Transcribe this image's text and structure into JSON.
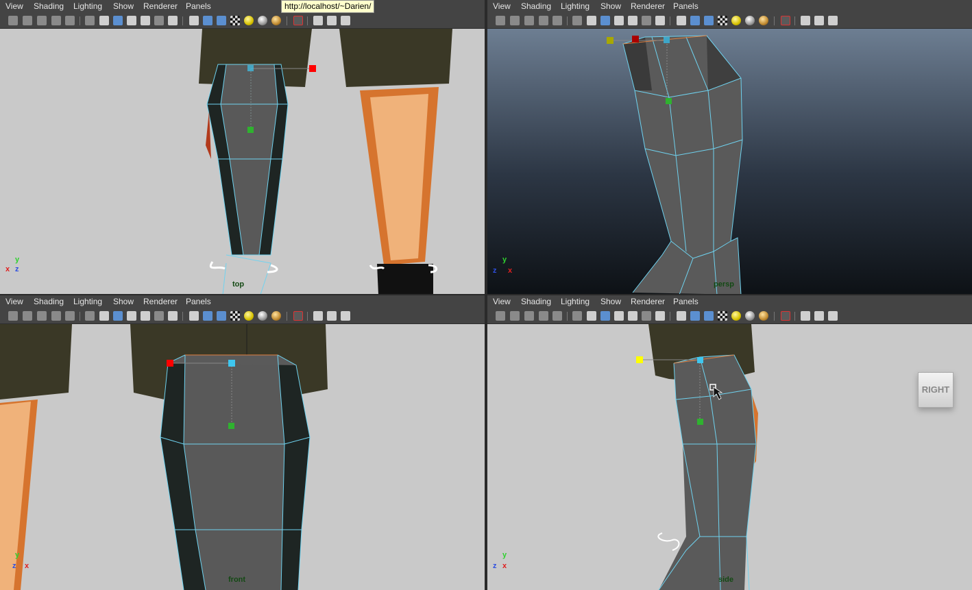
{
  "menu": [
    "View",
    "Shading",
    "Lighting",
    "Show",
    "Renderer",
    "Panels"
  ],
  "tooltip": "http://localhost/~Darien/",
  "viewports": {
    "top": {
      "label": "top",
      "axis": {
        "a": "y",
        "b": "x",
        "c": "z"
      }
    },
    "persp": {
      "label": "persp",
      "axis": {
        "a": "y",
        "b": "z",
        "c": "x"
      }
    },
    "front": {
      "label": "front",
      "axis": {
        "a": "y",
        "b": "z",
        "c": "x"
      }
    },
    "side": {
      "label": "side",
      "axis": {
        "a": "y",
        "b": "z",
        "c": "x"
      },
      "viewcube": "RIGHT"
    }
  },
  "toolbar_icons": [
    "camera-icon",
    "camera-attr-icon",
    "bookmark-icon",
    "image-plane-icon",
    "grid-icon",
    "wireframe-icon",
    "smooth-shade-icon",
    "textured-icon",
    "lights-icon",
    "xray-icon",
    "isolate-icon",
    "select-icon",
    "resolution-gate-icon"
  ],
  "colors": {
    "panel_bg": "#444444",
    "ortho_bg": "#c9c9c9",
    "persp_top": "#6d7e92",
    "persp_bottom": "#101418",
    "mesh_face": "#5a5a5a",
    "mesh_edge": "#6fd3f0",
    "handle_red": "#ff0000",
    "handle_cyan": "#3ec6ef",
    "handle_green": "#2fb22f",
    "handle_yellow": "#ffff00",
    "shorts": "#3a3826",
    "skin": "#f0b27a"
  }
}
